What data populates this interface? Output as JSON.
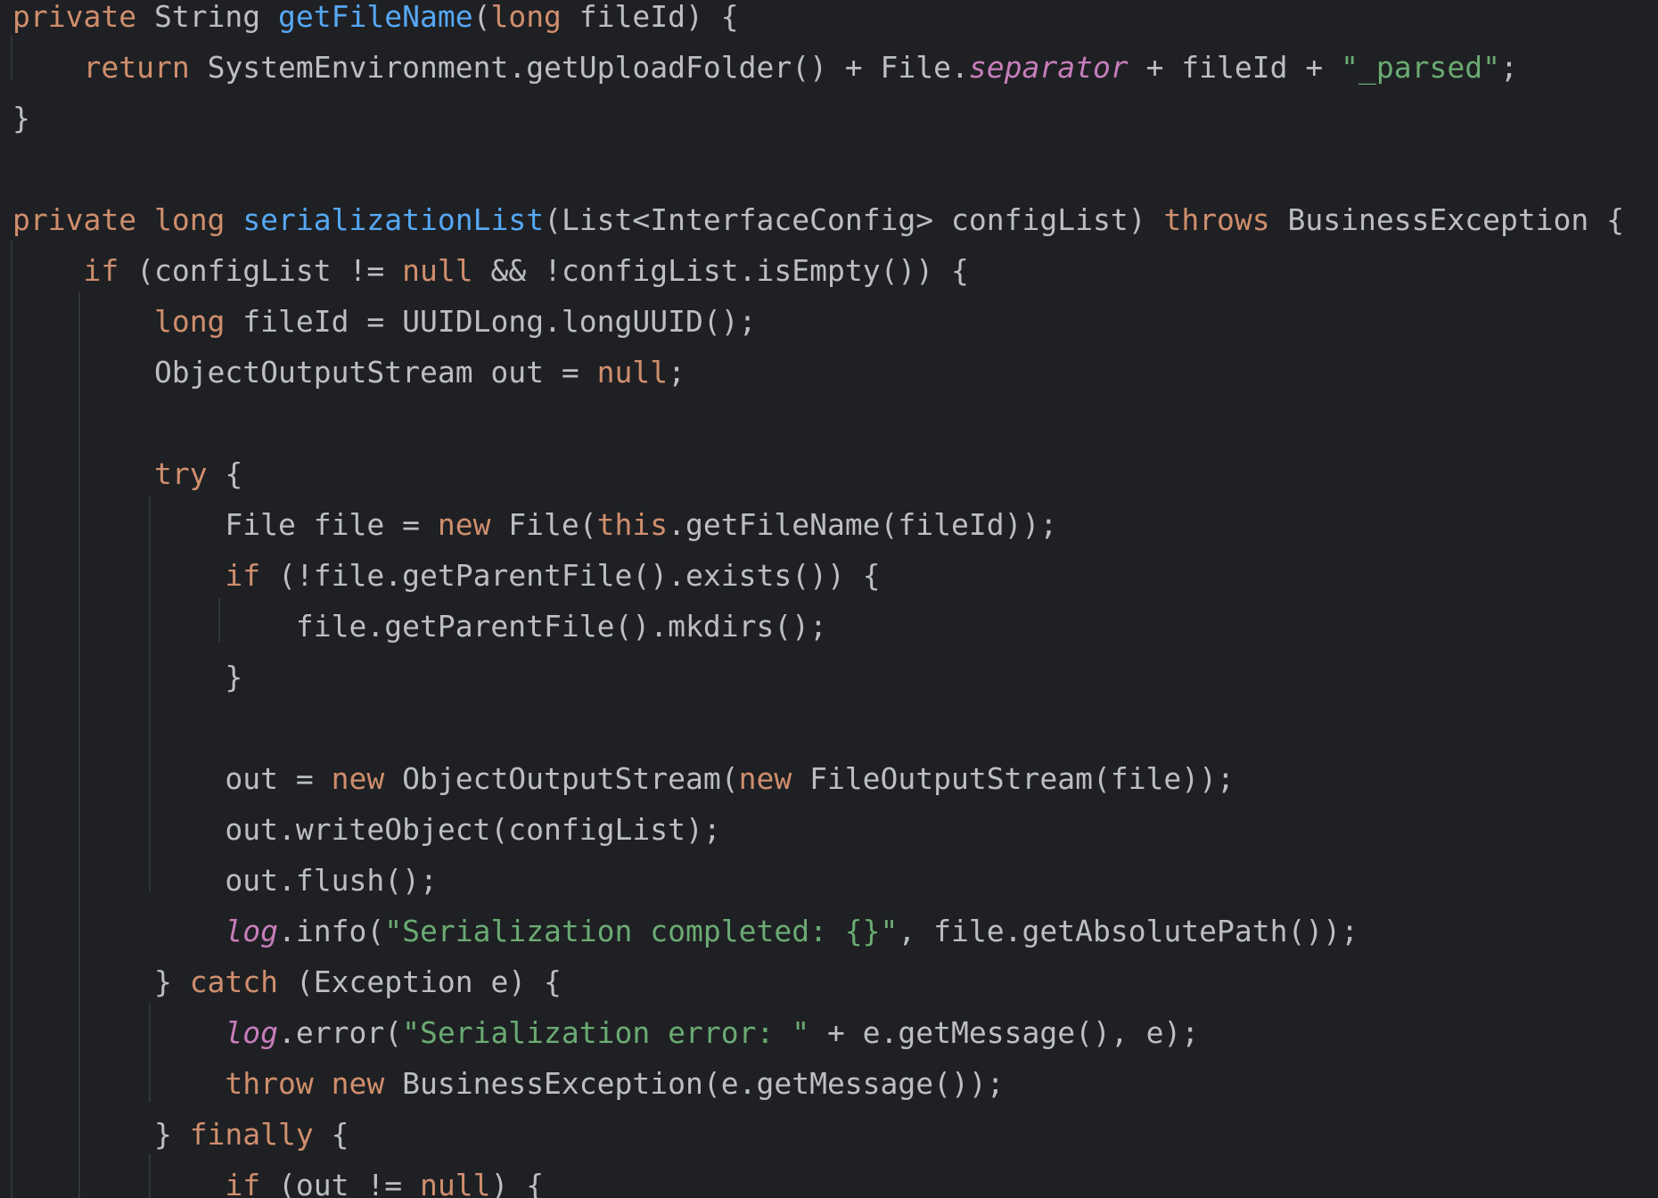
{
  "editor": {
    "language": "Java",
    "theme_colors": {
      "background": "#1f2023",
      "keyword": "#cf8e6d",
      "method_declaration": "#56a8f5",
      "string": "#6aab73",
      "static_field": "#c77dbb",
      "plain": "#bcbec4",
      "indent_guide": "#313438"
    },
    "lines": [
      [
        {
          "t": "private",
          "c": "kw"
        },
        {
          "t": " String ",
          "c": "pl"
        },
        {
          "t": "getFileName",
          "c": "fn"
        },
        {
          "t": "(",
          "c": "pl"
        },
        {
          "t": "long",
          "c": "kw"
        },
        {
          "t": " fileId) {",
          "c": "pl"
        }
      ],
      [
        {
          "t": "    ",
          "c": "pl"
        },
        {
          "t": "return",
          "c": "kw"
        },
        {
          "t": " SystemEnvironment.getUploadFolder() + File.",
          "c": "pl"
        },
        {
          "t": "separator",
          "c": "st"
        },
        {
          "t": " + fileId + ",
          "c": "pl"
        },
        {
          "t": "\"_parsed\"",
          "c": "str"
        },
        {
          "t": ";",
          "c": "pl"
        }
      ],
      [
        {
          "t": "}",
          "c": "pl"
        }
      ],
      [],
      [
        {
          "t": "private",
          "c": "kw"
        },
        {
          "t": " ",
          "c": "pl"
        },
        {
          "t": "long",
          "c": "kw"
        },
        {
          "t": " ",
          "c": "pl"
        },
        {
          "t": "serializationList",
          "c": "fn"
        },
        {
          "t": "(List<InterfaceConfig> configList) ",
          "c": "pl"
        },
        {
          "t": "throws",
          "c": "kw"
        },
        {
          "t": " BusinessException {",
          "c": "pl"
        }
      ],
      [
        {
          "t": "    ",
          "c": "pl"
        },
        {
          "t": "if",
          "c": "kw"
        },
        {
          "t": " (configList != ",
          "c": "pl"
        },
        {
          "t": "null",
          "c": "kw"
        },
        {
          "t": " && !configList.isEmpty()) {",
          "c": "pl"
        }
      ],
      [
        {
          "t": "        ",
          "c": "pl"
        },
        {
          "t": "long",
          "c": "kw"
        },
        {
          "t": " fileId = UUIDLong.longUUID();",
          "c": "pl"
        }
      ],
      [
        {
          "t": "        ObjectOutputStream out = ",
          "c": "pl"
        },
        {
          "t": "null",
          "c": "kw"
        },
        {
          "t": ";",
          "c": "pl"
        }
      ],
      [],
      [
        {
          "t": "        ",
          "c": "pl"
        },
        {
          "t": "try",
          "c": "kw"
        },
        {
          "t": " {",
          "c": "pl"
        }
      ],
      [
        {
          "t": "            File file = ",
          "c": "pl"
        },
        {
          "t": "new",
          "c": "kw"
        },
        {
          "t": " File(",
          "c": "pl"
        },
        {
          "t": "this",
          "c": "kw"
        },
        {
          "t": ".getFileName(fileId));",
          "c": "pl"
        }
      ],
      [
        {
          "t": "            ",
          "c": "pl"
        },
        {
          "t": "if",
          "c": "kw"
        },
        {
          "t": " (!file.getParentFile().exists()) {",
          "c": "pl"
        }
      ],
      [
        {
          "t": "                file.getParentFile().mkdirs();",
          "c": "pl"
        }
      ],
      [
        {
          "t": "            }",
          "c": "pl"
        }
      ],
      [],
      [
        {
          "t": "            out = ",
          "c": "pl"
        },
        {
          "t": "new",
          "c": "kw"
        },
        {
          "t": " ObjectOutputStream(",
          "c": "pl"
        },
        {
          "t": "new",
          "c": "kw"
        },
        {
          "t": " FileOutputStream(file));",
          "c": "pl"
        }
      ],
      [
        {
          "t": "            out.writeObject(configList);",
          "c": "pl"
        }
      ],
      [
        {
          "t": "            out.flush();",
          "c": "pl"
        }
      ],
      [
        {
          "t": "            ",
          "c": "pl"
        },
        {
          "t": "log",
          "c": "st"
        },
        {
          "t": ".info(",
          "c": "pl"
        },
        {
          "t": "\"Serialization completed: {}\"",
          "c": "str"
        },
        {
          "t": ", file.getAbsolutePath());",
          "c": "pl"
        }
      ],
      [
        {
          "t": "        } ",
          "c": "pl"
        },
        {
          "t": "catch",
          "c": "kw"
        },
        {
          "t": " (Exception e) {",
          "c": "pl"
        }
      ],
      [
        {
          "t": "            ",
          "c": "pl"
        },
        {
          "t": "log",
          "c": "st"
        },
        {
          "t": ".error(",
          "c": "pl"
        },
        {
          "t": "\"Serialization error: \"",
          "c": "str"
        },
        {
          "t": " + e.getMessage(), e);",
          "c": "pl"
        }
      ],
      [
        {
          "t": "            ",
          "c": "pl"
        },
        {
          "t": "throw",
          "c": "kw"
        },
        {
          "t": " ",
          "c": "pl"
        },
        {
          "t": "new",
          "c": "kw"
        },
        {
          "t": " BusinessException(e.getMessage());",
          "c": "pl"
        }
      ],
      [
        {
          "t": "        } ",
          "c": "pl"
        },
        {
          "t": "finally",
          "c": "kw"
        },
        {
          "t": " {",
          "c": "pl"
        }
      ],
      [
        {
          "t": "            ",
          "c": "pl"
        },
        {
          "t": "if",
          "c": "kw"
        },
        {
          "t": " (out != ",
          "c": "pl"
        },
        {
          "t": "null",
          "c": "kw"
        },
        {
          "t": ") {",
          "c": "pl"
        }
      ]
    ]
  }
}
